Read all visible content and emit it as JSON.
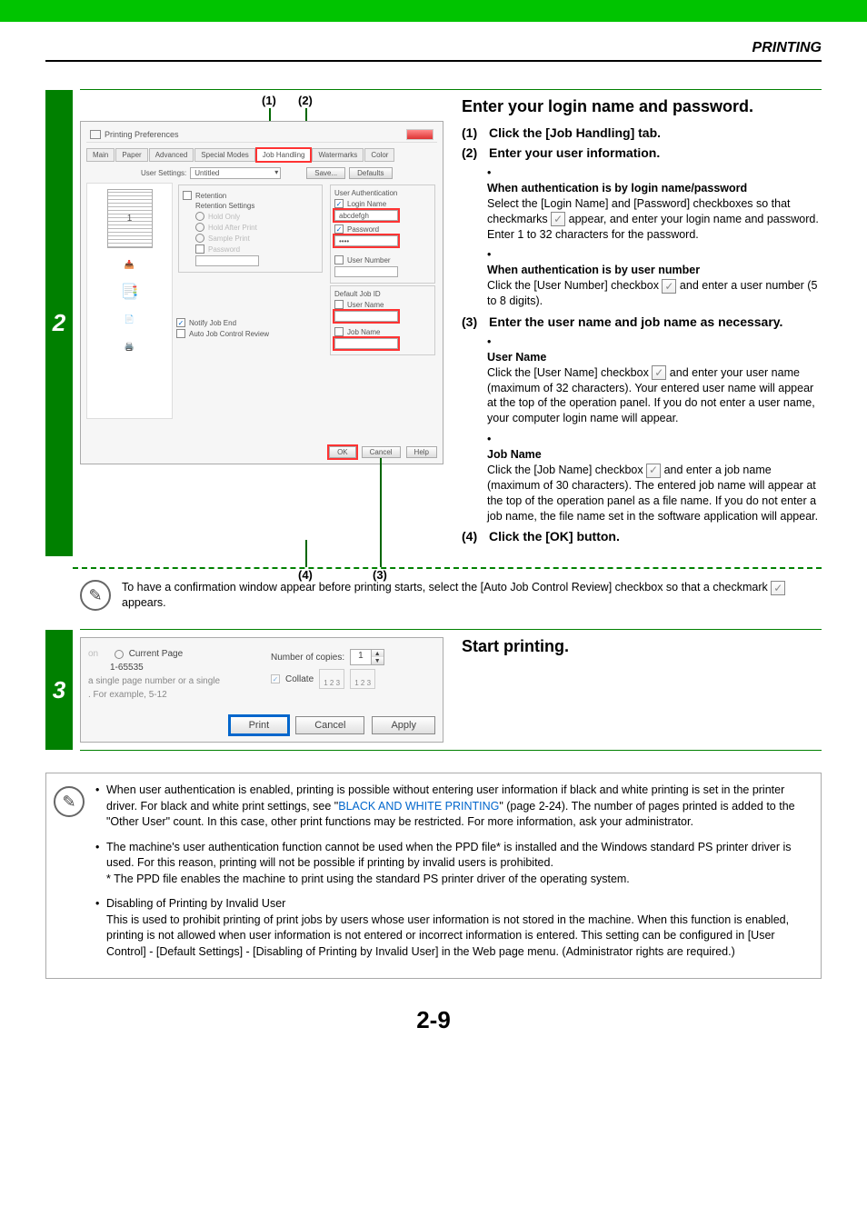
{
  "header": {
    "title": "PRINTING"
  },
  "step2": {
    "number": "2",
    "callouts": {
      "one": "(1)",
      "two": "(2)",
      "three": "(3)",
      "four": "(4)"
    },
    "dialog": {
      "title": "Printing Preferences",
      "tabs": [
        "Main",
        "Paper",
        "Advanced",
        "Special Modes",
        "Job Handling",
        "Watermarks",
        "Color"
      ],
      "active_tab_index": 4,
      "user_settings_label": "User Settings:",
      "user_settings_value": "Untitled",
      "save_btn": "Save...",
      "defaults_btn": "Defaults",
      "left_group": {
        "retention": "Retention",
        "retention_settings": "Retention Settings",
        "hold_only": "Hold Only",
        "hold_after_print": "Hold After Print",
        "sample_print": "Sample Print",
        "password": "Password",
        "notify": "Notify Job End",
        "auto_review": "Auto Job Control Review"
      },
      "right_group": {
        "title": "User Authentication",
        "login_name": "Login Name",
        "login_name_val": "abcdefgh",
        "password": "Password",
        "password_val": "••••",
        "user_number": "User Number",
        "default_job_id": "Default Job ID",
        "user_name": "User Name",
        "job_name": "Job Name"
      },
      "ok": "OK",
      "cancel": "Cancel",
      "help": "Help",
      "paper_label": "1"
    },
    "right": {
      "heading": "Enter your login name and password.",
      "items": [
        {
          "num": "(1)",
          "title": "Click the [Job Handling] tab."
        },
        {
          "num": "(2)",
          "title": "Enter your user information.",
          "bullets": [
            {
              "lead": "When authentication is by login name/password",
              "body_a": "Select the [Login Name] and [Password] checkboxes so that checkmarks ",
              "body_b": " appear, and enter your login name and password. Enter 1 to 32 characters for the password."
            },
            {
              "lead": "When authentication is by user number",
              "body_a": "Click the [User Number] checkbox ",
              "body_b": " and enter a user number (5 to 8 digits)."
            }
          ]
        },
        {
          "num": "(3)",
          "title": "Enter the user name and job name as necessary.",
          "bullets": [
            {
              "lead": "User Name",
              "body_a": "Click the [User Name] checkbox ",
              "body_b": " and enter your user name (maximum of 32 characters). Your entered user name will appear at the top of the operation panel. If you do not enter a user name, your computer login name will appear."
            },
            {
              "lead": "Job Name",
              "body_a": "Click the [Job Name] checkbox ",
              "body_b": " and enter a job name (maximum of 30 characters). The entered job name will appear at the top of the operation panel as a file name. If you do not enter a job name, the file name set in the software application will appear."
            }
          ]
        },
        {
          "num": "(4)",
          "title": "Click the [OK] button."
        }
      ]
    },
    "note_after": {
      "text_a": "To have a confirmation window appear before printing starts, select the [Auto Job Control Review] checkbox so that a checkmark ",
      "text_b": " appears."
    }
  },
  "step3": {
    "number": "3",
    "dialog": {
      "range_current": "Current Page",
      "range_hint1": "1-65535",
      "range_hint2": "a single page number or a single",
      "range_hint3": ". For example, 5-12",
      "copies_label": "Number of copies:",
      "copies_val": "1",
      "collate": "Collate",
      "collate_icon_text": "1 2 3",
      "print": "Print",
      "cancel": "Cancel",
      "apply": "Apply"
    },
    "heading": "Start printing."
  },
  "endnotes": {
    "n1a": "When user authentication is enabled, printing is possible without entering user information if black and white printing is set in the printer driver. For black and white print settings, see \"",
    "n1link": "BLACK AND WHITE PRINTING",
    "n1b": "\" (page 2-24). The number of pages printed is added to the \"Other User\" count. In this case, other print functions may be restricted. For more information, ask your administrator.",
    "n2": "The machine's user authentication function cannot be used when the PPD file* is installed and the Windows standard PS printer driver is used. For this reason, printing will not be possible if printing by invalid users is prohibited.",
    "n2star": "* The PPD file enables the machine to print using the standard PS printer driver of the operating system.",
    "n3lead": "Disabling of Printing by Invalid User",
    "n3body": "This is used to prohibit printing of print jobs by users whose user information is not stored in the machine. When this function is enabled, printing is not allowed when user information is not entered or incorrect information is entered. This setting can be configured in [User Control] - [Default Settings] - [Disabling of Printing by Invalid User] in the Web page menu. (Administrator rights are required.)"
  },
  "page_number": "2-9"
}
